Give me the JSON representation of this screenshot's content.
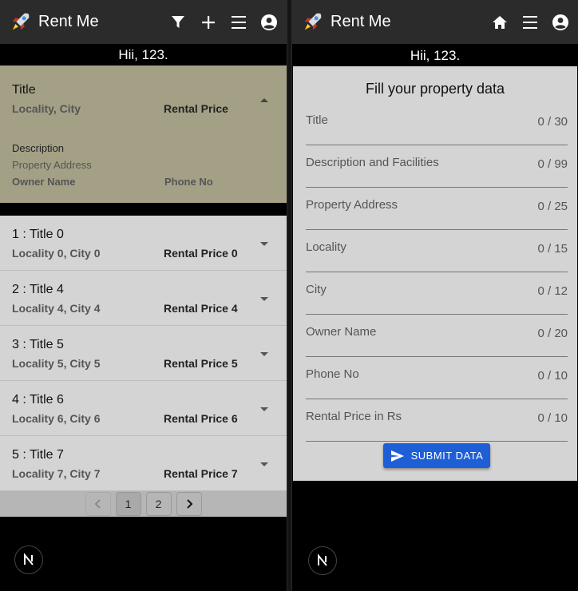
{
  "left": {
    "appbar": {
      "brand": "Rent Me",
      "icons": [
        "rocket-logo",
        "filter-icon",
        "plus-icon",
        "menu-icon",
        "account-icon"
      ]
    },
    "greeting": "Hii, 123.",
    "header_card": {
      "title": "Title",
      "locality_city": "Locality, City",
      "rental_price": "Rental Price",
      "description": "Description",
      "address": "Property Address",
      "owner": "Owner Name",
      "phone": "Phone No"
    },
    "rows": [
      {
        "title": "1 : Title 0",
        "loc": "Locality 0, City 0",
        "price": "Rental Price 0"
      },
      {
        "title": "2 : Title 4",
        "loc": "Locality 4, City 4",
        "price": "Rental Price 4"
      },
      {
        "title": "3 : Title 5",
        "loc": "Locality 5, City 5",
        "price": "Rental Price 5"
      },
      {
        "title": "4 : Title 6",
        "loc": "Locality 6, City 6",
        "price": "Rental Price 6"
      },
      {
        "title": "5 : Title 7",
        "loc": "Locality 7, City 7",
        "price": "Rental Price 7"
      }
    ],
    "pagination": {
      "pages": [
        "1",
        "2"
      ],
      "current": "1"
    }
  },
  "right": {
    "appbar": {
      "brand": "Rent Me",
      "icons": [
        "rocket-logo",
        "home-icon",
        "menu-icon",
        "account-icon"
      ]
    },
    "greeting": "Hii, 123.",
    "form": {
      "title": "Fill your property data",
      "fields": [
        {
          "label": "Title",
          "counter": "0 / 30"
        },
        {
          "label": "Description and Facilities",
          "counter": "0 / 99"
        },
        {
          "label": "Property Address",
          "counter": "0 / 25"
        },
        {
          "label": "Locality",
          "counter": "0 / 15"
        },
        {
          "label": "City",
          "counter": "0 / 12"
        },
        {
          "label": "Owner Name",
          "counter": "0 / 20"
        },
        {
          "label": "Phone No",
          "counter": "0 / 10"
        },
        {
          "label": "Rental Price in Rs",
          "counter": "0 / 10"
        }
      ],
      "submit_label": "SUBMIT DATA"
    }
  },
  "colors": {
    "appbar": "#2b2b2b",
    "header_card": "#a3a085",
    "row_bg": "#d4d4d4",
    "submit": "#1f5fd6"
  }
}
